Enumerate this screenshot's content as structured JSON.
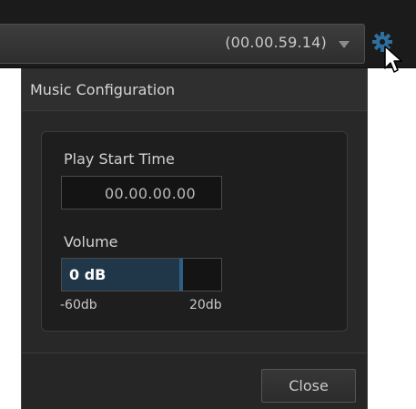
{
  "toolbar": {
    "duration_value": "(00.00.59.14)",
    "dropdown_icon": "chevron-down-icon",
    "settings_icon": "gear-icon",
    "accent_color": "#2e6f9e"
  },
  "dialog": {
    "title": "Music Configuration",
    "play_start": {
      "label": "Play Start Time",
      "value": "00.00.00.00"
    },
    "volume": {
      "label": "Volume",
      "value_text": "0 dB",
      "value_db": 0,
      "min_label": "-60db",
      "max_label": "20db",
      "min_db": -60,
      "max_db": 20
    },
    "close_label": "Close"
  }
}
